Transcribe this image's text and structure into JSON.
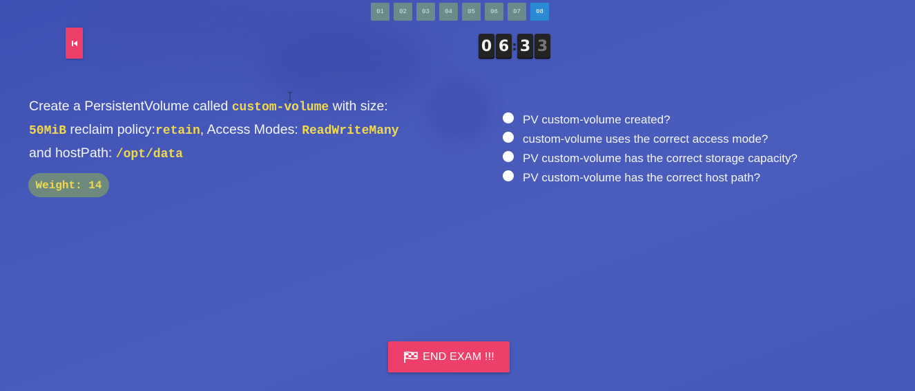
{
  "nav": {
    "questions": [
      "01",
      "02",
      "03",
      "04",
      "05",
      "06",
      "07",
      "08"
    ],
    "active_index": 7,
    "back_icon": "skip-back-icon"
  },
  "timer": {
    "digits": [
      "0",
      "6",
      "3",
      "3"
    ],
    "separator": ":"
  },
  "question": {
    "t1": "Create a PersistentVolume called ",
    "c1": "custom-volume",
    "t2": " with size: ",
    "c2": "50MiB",
    "t3": " reclaim policy:",
    "c3": "retain",
    "t4": ", Access Modes: ",
    "c4": "ReadWriteMany",
    "t5": " and hostPath: ",
    "c5": "/opt/data",
    "weight": "Weight: 14"
  },
  "checklist": [
    "PV custom-volume created?",
    "custom-volume uses the correct access mode?",
    "PV custom-volume has the correct storage capacity?",
    "PV custom-volume has the correct host path?"
  ],
  "end_exam": {
    "label": "END EXAM !!!",
    "icon": "flag-checkered-icon"
  },
  "colors": {
    "background": "#4759b9",
    "accent_pink": "#ee3f6a",
    "code_yellow": "#f1d94e",
    "nav_button": "#6b8a8a",
    "nav_active": "#2a8ad4"
  }
}
